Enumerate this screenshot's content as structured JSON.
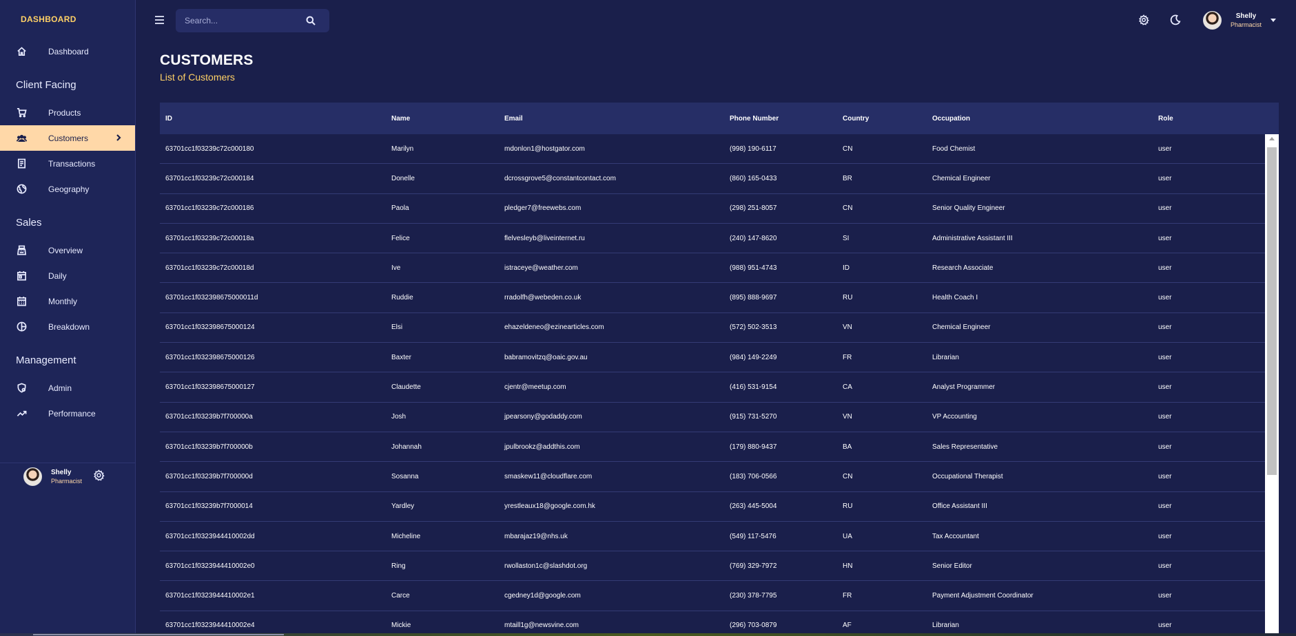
{
  "brand": "DASHBOARD",
  "nav": {
    "dashboard": "Dashboard",
    "sections": {
      "client_facing": "Client Facing",
      "sales": "Sales",
      "management": "Management"
    },
    "items": {
      "products": "Products",
      "customers": "Customers",
      "transactions": "Transactions",
      "geography": "Geography",
      "overview": "Overview",
      "daily": "Daily",
      "monthly": "Monthly",
      "breakdown": "Breakdown",
      "admin": "Admin",
      "performance": "Performance"
    },
    "active": "customers"
  },
  "user": {
    "name": "Shelly",
    "role": "Pharmacist"
  },
  "search": {
    "placeholder": "Search..."
  },
  "header": {
    "title": "CUSTOMERS",
    "subtitle": "List of Customers"
  },
  "table": {
    "columns": [
      "ID",
      "Name",
      "Email",
      "Phone Number",
      "Country",
      "Occupation",
      "Role"
    ],
    "rows": [
      [
        "63701cc1f03239c72c000180",
        "Marilyn",
        "mdonlon1@hostgator.com",
        "(998) 190-6117",
        "CN",
        "Food Chemist",
        "user"
      ],
      [
        "63701cc1f03239c72c000184",
        "Donelle",
        "dcrossgrove5@constantcontact.com",
        "(860) 165-0433",
        "BR",
        "Chemical Engineer",
        "user"
      ],
      [
        "63701cc1f03239c72c000186",
        "Paola",
        "pledger7@freewebs.com",
        "(298) 251-8057",
        "CN",
        "Senior Quality Engineer",
        "user"
      ],
      [
        "63701cc1f03239c72c00018a",
        "Felice",
        "flelvesleyb@liveinternet.ru",
        "(240) 147-8620",
        "SI",
        "Administrative Assistant III",
        "user"
      ],
      [
        "63701cc1f03239c72c00018d",
        "Ive",
        "istraceye@weather.com",
        "(988) 951-4743",
        "ID",
        "Research Associate",
        "user"
      ],
      [
        "63701cc1f032398675000011d",
        "Ruddie",
        "rradolfh@webeden.co.uk",
        "(895) 888-9697",
        "RU",
        "Health Coach I",
        "user"
      ],
      [
        "63701cc1f032398675000124",
        "Elsi",
        "ehazeldeneo@ezinearticles.com",
        "(572) 502-3513",
        "VN",
        "Chemical Engineer",
        "user"
      ],
      [
        "63701cc1f032398675000126",
        "Baxter",
        "babramovitzq@oaic.gov.au",
        "(984) 149-2249",
        "FR",
        "Librarian",
        "user"
      ],
      [
        "63701cc1f032398675000127",
        "Claudette",
        "cjentr@meetup.com",
        "(416) 531-9154",
        "CA",
        "Analyst Programmer",
        "user"
      ],
      [
        "63701cc1f03239b7f700000a",
        "Josh",
        "jpearsony@godaddy.com",
        "(915) 731-5270",
        "VN",
        "VP Accounting",
        "user"
      ],
      [
        "63701cc1f03239b7f700000b",
        "Johannah",
        "jpulbrookz@addthis.com",
        "(179) 880-9437",
        "BA",
        "Sales Representative",
        "user"
      ],
      [
        "63701cc1f03239b7f700000d",
        "Sosanna",
        "smaskew11@cloudflare.com",
        "(183) 706-0566",
        "CN",
        "Occupational Therapist",
        "user"
      ],
      [
        "63701cc1f03239b7f7000014",
        "Yardley",
        "yrestleaux18@google.com.hk",
        "(263) 445-5004",
        "RU",
        "Office Assistant III",
        "user"
      ],
      [
        "63701cc1f0323944410002dd",
        "Micheline",
        "mbarajaz19@nhs.uk",
        "(549) 117-5476",
        "UA",
        "Tax Accountant",
        "user"
      ],
      [
        "63701cc1f0323944410002e0",
        "Ring",
        "rwollaston1c@slashdot.org",
        "(769) 329-7972",
        "HN",
        "Senior Editor",
        "user"
      ],
      [
        "63701cc1f0323944410002e1",
        "Carce",
        "cgedney1d@google.com",
        "(230) 378-7795",
        "FR",
        "Payment Adjustment Coordinator",
        "user"
      ],
      [
        "63701cc1f0323944410002e4",
        "Mickie",
        "mtaill1g@newsvine.com",
        "(296) 703-0879",
        "AF",
        "Librarian",
        "user"
      ]
    ]
  }
}
